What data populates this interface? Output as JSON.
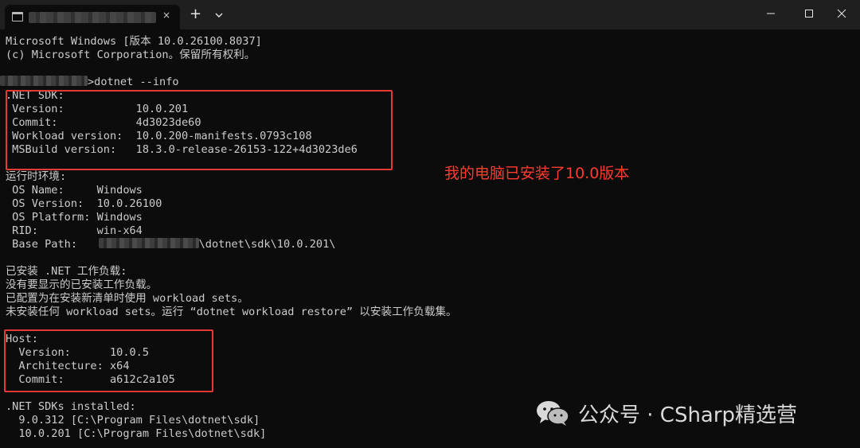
{
  "window": {
    "tab_title": "",
    "close_tab_glyph": "×",
    "new_tab_glyph": "+",
    "minimize_icon": "minimize-icon",
    "maximize_icon": "maximize-icon",
    "close_icon": "close-icon"
  },
  "terminal": {
    "banner_line1": "Microsoft Windows [版本 10.0.26100.8037]",
    "banner_line2": "(c) Microsoft Corporation。保留所有权利。",
    "prompt_command": ">dotnet --info",
    "sdk_header": ".NET SDK:",
    "sdk_version": " Version:           10.0.201",
    "sdk_commit": " Commit:            4d3023de60",
    "sdk_workload": " Workload version:  10.0.200-manifests.0793c108",
    "sdk_msbuild": " MSBuild version:   18.3.0-release-26153-122+4d3023de6",
    "runtime_header": "运行时环境:",
    "os_name": " OS Name:     Windows",
    "os_version": " OS Version:  10.0.26100",
    "os_platform": " OS Platform: Windows",
    "rid": " RID:         win-x64",
    "base_path_label": " Base Path:   ",
    "base_path_suffix": "\\dotnet\\sdk\\10.0.201\\",
    "workloads_header": "已安装 .NET 工作负载:",
    "workloads_none": "没有要显示的已安装工作负载。",
    "workloads_configured": "已配置为在安装新清单时使用 workload sets。",
    "workloads_hint": "未安装任何 workload sets。运行 “dotnet workload restore” 以安装工作负载集。",
    "host_header": "Host:",
    "host_version": "  Version:      10.0.5",
    "host_arch": "  Architecture: x64",
    "host_commit": "  Commit:       a612c2a105",
    "sdks_header": ".NET SDKs installed:",
    "sdk_item1": "  9.0.312 [C:\\Program Files\\dotnet\\sdk]",
    "sdk_item2": "  10.0.201 [C:\\Program Files\\dotnet\\sdk]"
  },
  "annotation": "我的电脑已安装了10.0版本",
  "watermark": {
    "icon": "wechat-icon",
    "text": "公众号 · CSharp精选营"
  },
  "colors": {
    "background": "#0c0c0c",
    "titlebar": "#1f1f1f",
    "text": "#cccccc",
    "highlight_box": "#e53935",
    "annotation": "#ff3b30"
  }
}
